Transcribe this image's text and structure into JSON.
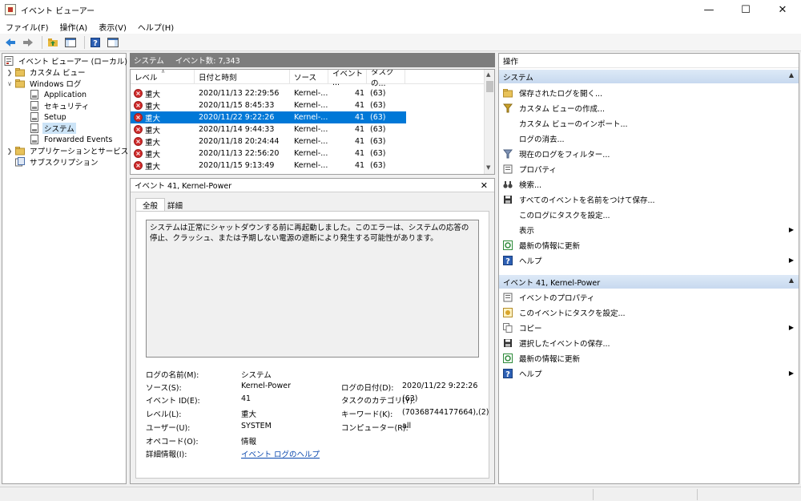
{
  "window": {
    "title": "イベント ビューアー",
    "minimize": "—",
    "maximize": "☐",
    "close": "✕"
  },
  "menu": [
    "ファイル(F)",
    "操作(A)",
    "表示(V)",
    "ヘルプ(H)"
  ],
  "tree": {
    "root": "イベント ビューアー (ローカル)",
    "custom_views": "カスタム ビュー",
    "windows_logs": "Windows ログ",
    "application": "Application",
    "security": "セキュリティ",
    "setup": "Setup",
    "system": "システム",
    "forwarded": "Forwarded Events",
    "apps_services": "アプリケーションとサービス ログ",
    "subscriptions": "サブスクリプション"
  },
  "list_header": {
    "log_name": "システム",
    "event_count": "イベント数: 7,343"
  },
  "columns": [
    "レベル",
    "日付と時刻",
    "ソース",
    "イベント ...",
    "タスクの..."
  ],
  "events": [
    {
      "level": "重大",
      "date": "2020/11/13 22:29:56",
      "source": "Kernel-...",
      "id": "41",
      "task": "(63)"
    },
    {
      "level": "重大",
      "date": "2020/11/15 8:45:33",
      "source": "Kernel-...",
      "id": "41",
      "task": "(63)"
    },
    {
      "level": "重大",
      "date": "2020/11/22 9:22:26",
      "source": "Kernel-...",
      "id": "41",
      "task": "(63)"
    },
    {
      "level": "重大",
      "date": "2020/11/14 9:44:33",
      "source": "Kernel-...",
      "id": "41",
      "task": "(63)"
    },
    {
      "level": "重大",
      "date": "2020/11/18 20:24:44",
      "source": "Kernel-...",
      "id": "41",
      "task": "(63)"
    },
    {
      "level": "重大",
      "date": "2020/11/13 22:56:20",
      "source": "Kernel-...",
      "id": "41",
      "task": "(63)"
    },
    {
      "level": "重大",
      "date": "2020/11/15 9:13:49",
      "source": "Kernel-...",
      "id": "41",
      "task": "(63)"
    }
  ],
  "detail": {
    "title": "イベント 41, Kernel-Power",
    "close": "✕",
    "tab_general": "全般",
    "tab_details": "詳細",
    "description": "システムは正常にシャットダウンする前に再起動しました。このエラーは、システムの応答の停止、クラッシュ、または予期しない電源の遮断により発生する可能性があります。",
    "labels": {
      "log_name": "ログの名前(M):",
      "source": "ソース(S):",
      "event_id": "イベント ID(E):",
      "level": "レベル(L):",
      "user": "ユーザー(U):",
      "opcode": "オペコード(O):",
      "more_info": "詳細情報(I):",
      "logged": "ログの日付(D):",
      "task_category": "タスクのカテゴリ(Y):",
      "keywords": "キーワード(K):",
      "computer": "コンピューター(R):"
    },
    "values": {
      "log_name": "システム",
      "source": "Kernel-Power",
      "event_id": "41",
      "level": "重大",
      "user": "SYSTEM",
      "opcode": "情報",
      "more_info": "イベント ログのヘルプ",
      "logged": "2020/11/22 9:22:26",
      "task_category": "(63)",
      "keywords": "(70368744177664),(2)",
      "computer": "all"
    }
  },
  "actions": {
    "title": "操作",
    "section_system": "システム",
    "system_items": [
      "保存されたログを開く...",
      "カスタム ビューの作成...",
      "カスタム ビューのインポート...",
      "ログの消去...",
      "現在のログをフィルター...",
      "プロパティ",
      "検索...",
      "すべてのイベントを名前をつけて保存...",
      "このログにタスクを設定...",
      "表示",
      "最新の情報に更新",
      "ヘルプ"
    ],
    "section_event": "イベント 41, Kernel-Power",
    "event_items": [
      "イベントのプロパティ",
      "このイベントにタスクを設定...",
      "コピー",
      "選択したイベントの保存...",
      "最新の情報に更新",
      "ヘルプ"
    ]
  },
  "colors": {
    "selection": "#0078d7",
    "error": "#d12b2b",
    "section_header": "#c7d9ef",
    "pane_header": "#7d7d7d"
  }
}
